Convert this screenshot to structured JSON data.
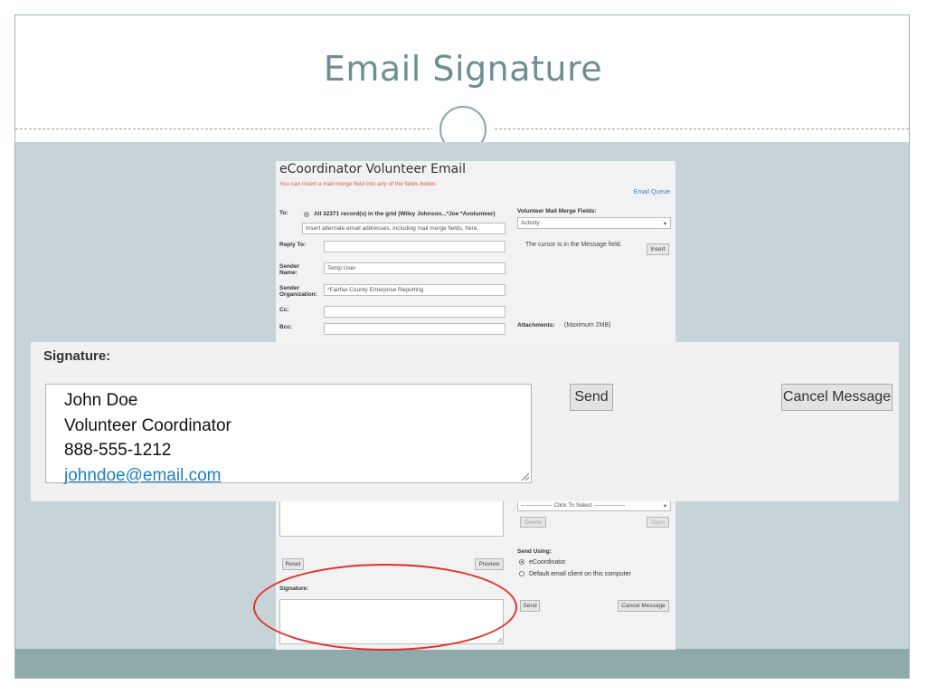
{
  "slide": {
    "title": "Email Signature"
  },
  "form": {
    "title": "eCoordinator Volunteer Email",
    "note": "You can insert a mail merge field into any of the fields below.",
    "email_queue": "Email Queue",
    "to_label": "To:",
    "to_option": "All 32371 record(s) in the grid (Wiley Johnson...*Joe *Avolunteer)",
    "to_placeholder": "Insert alternate email addresses, including mail merge fields, here.",
    "reply_to_label": "Reply To:",
    "reply_to_value": "",
    "sender_name_label": "Sender Name:",
    "sender_name_value": "Temp User",
    "sender_org_label": "Sender Organization:",
    "sender_org_value": "*Fairfax County Enterprise Reporting",
    "cc_label": "Cc:",
    "bcc_label": "Bcc:",
    "merge_fields_label": "Volunteer Mail Merge Fields:",
    "merge_fields_value": "Activity",
    "cursor_note": "The cursor is in the Message field.",
    "insert_label": "Insert",
    "attachments_label": "Attachments:",
    "attachments_note": "(Maximum 2MB)",
    "click_to_select": "---------------- Click To Select ----------------",
    "delete_label": "Delete",
    "open_label": "Open",
    "reset_label": "Reset",
    "preview_label": "Preview",
    "send_using_label": "Send Using:",
    "send_option_1": "eCoordinator",
    "send_option_2": "Default email client on this computer",
    "signature_label": "Signature:",
    "send_label": "Send",
    "cancel_label": "Cancel Message"
  },
  "zoom": {
    "signature_label": "Signature:",
    "lines": [
      "John Doe",
      "Volunteer Coordinator",
      "888-555-1212",
      "johndoe@email.com"
    ],
    "send_label": "Send",
    "cancel_label": "Cancel Message"
  },
  "colors": {
    "accent": "#6e8f92",
    "band": "#c7d4d7",
    "highlight": "#e0302a",
    "link": "#1d7fc4"
  }
}
